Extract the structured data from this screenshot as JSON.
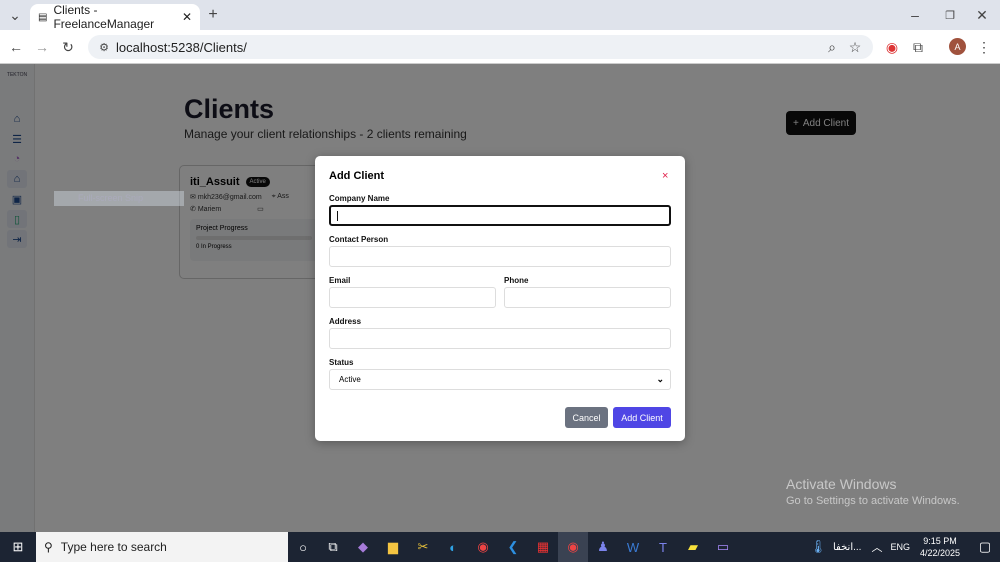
{
  "browser": {
    "tab_title": "Clients - FreelanceManager",
    "url": "localhost:5238/Clients/",
    "profile_initial": "A"
  },
  "sidebar": {
    "logo_text": "TEKTON",
    "items": [
      "home-icon",
      "list-icon",
      "timer-icon",
      "clients-icon",
      "projects-icon",
      "invoice-icon",
      "logout-icon"
    ]
  },
  "page": {
    "title": "Clients",
    "subtitle": "Manage your client relationships - 2 clients remaining",
    "add_button": "Add Client"
  },
  "client_card": {
    "name": "iti_Assuit",
    "status": "Active",
    "email": "mkh236@gmail.com",
    "address": "Ass",
    "contact": "Mariem",
    "progress_label": "Project Progress",
    "progress_count": "0 In Progress"
  },
  "snip_overlay": "Full-screen Snip",
  "modal": {
    "title": "Add Client",
    "close": "×",
    "fields": {
      "company": "Company Name",
      "contact": "Contact Person",
      "email": "Email",
      "phone": "Phone",
      "address": "Address",
      "status": "Status"
    },
    "status_value": "Active",
    "cancel": "Cancel",
    "submit": "Add Client"
  },
  "watermark": {
    "line1": "Activate Windows",
    "line2": "Go to Settings to activate Windows."
  },
  "taskbar": {
    "search_placeholder": "Type here to search",
    "weather": "انخفا...",
    "lang": "ENG",
    "time": "9:15 PM",
    "date": "4/22/2025"
  },
  "colors": {
    "primary": "#4f46e5",
    "cancel": "#6b7280",
    "close": "#e11d48"
  }
}
